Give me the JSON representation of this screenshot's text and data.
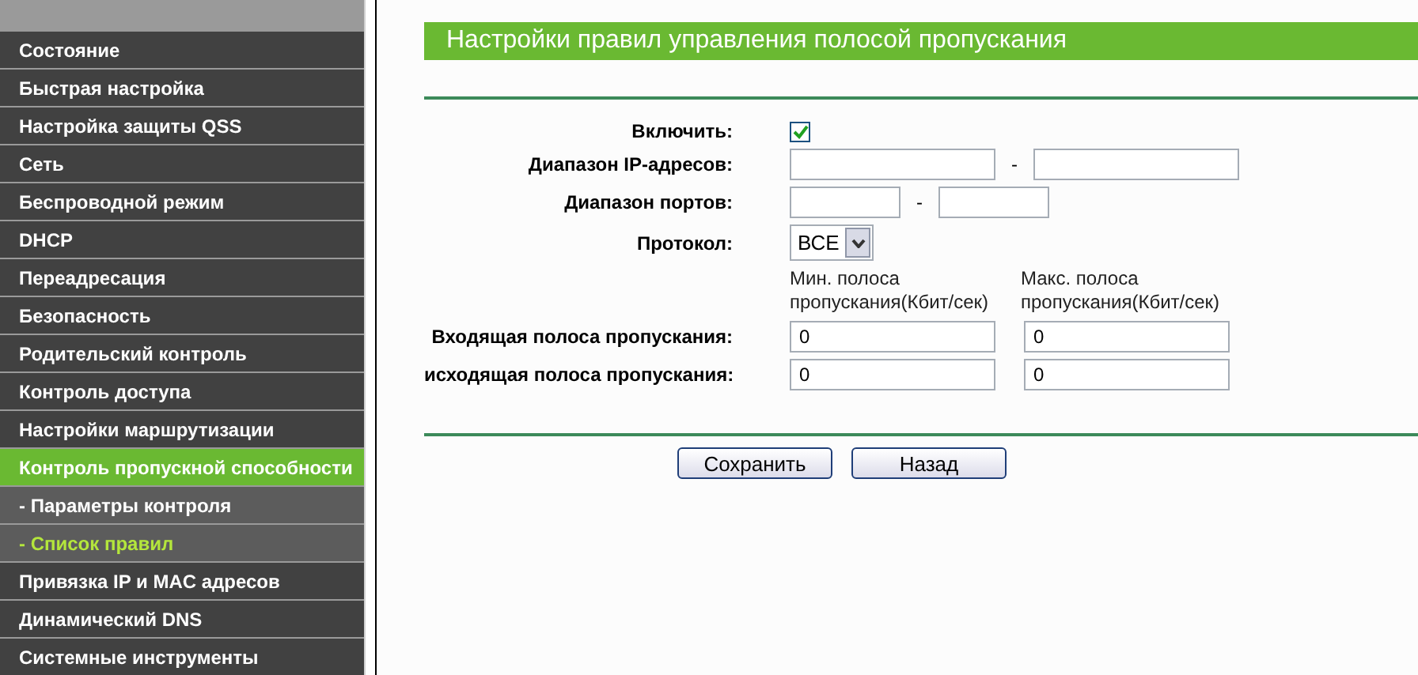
{
  "sidebar": {
    "items": [
      {
        "label": "Состояние",
        "selected": false
      },
      {
        "label": "Быстрая настройка",
        "selected": false
      },
      {
        "label": "Настройка защиты QSS",
        "selected": false
      },
      {
        "label": "Сеть",
        "selected": false
      },
      {
        "label": "Беспроводной режим",
        "selected": false
      },
      {
        "label": "DHCP",
        "selected": false
      },
      {
        "label": "Переадресация",
        "selected": false
      },
      {
        "label": "Безопасность",
        "selected": false
      },
      {
        "label": "Родительский контроль",
        "selected": false
      },
      {
        "label": "Контроль доступа",
        "selected": false
      },
      {
        "label": "Настройки маршрутизации",
        "selected": false
      },
      {
        "label": "Контроль пропускной способности",
        "selected": true,
        "children": [
          {
            "label": "- Параметры контроля",
            "selected": false
          },
          {
            "label": "- Список правил",
            "selected": true
          }
        ]
      },
      {
        "label": "Привязка IP и MAC адресов",
        "selected": false
      },
      {
        "label": "Динамический DNS",
        "selected": false
      },
      {
        "label": "Системные инструменты",
        "selected": false
      }
    ]
  },
  "panel": {
    "title": "Настройки правил управления полосой пропускания",
    "enable": {
      "label": "Включить:",
      "checked": true
    },
    "ip_range": {
      "label": "Диапазон IP-адресов:",
      "separator": "-"
    },
    "port_range": {
      "label": "Диапазон портов:",
      "separator": "-"
    },
    "protocol": {
      "label": "Протокол:",
      "value": "ВСЕ"
    },
    "column_headers": [
      "Мин. полоса пропускания(Кбит/сек)",
      "Макс. полоса пропускания(Кбит/сек)"
    ],
    "bandwidth_rows": [
      {
        "label": "Входящая полоса пропускания:",
        "min": "0",
        "max": "0"
      },
      {
        "label": "исходящая полоса пропускания:",
        "min": "0",
        "max": "0"
      }
    ],
    "buttons": [
      "Сохранить",
      "Назад"
    ]
  }
}
